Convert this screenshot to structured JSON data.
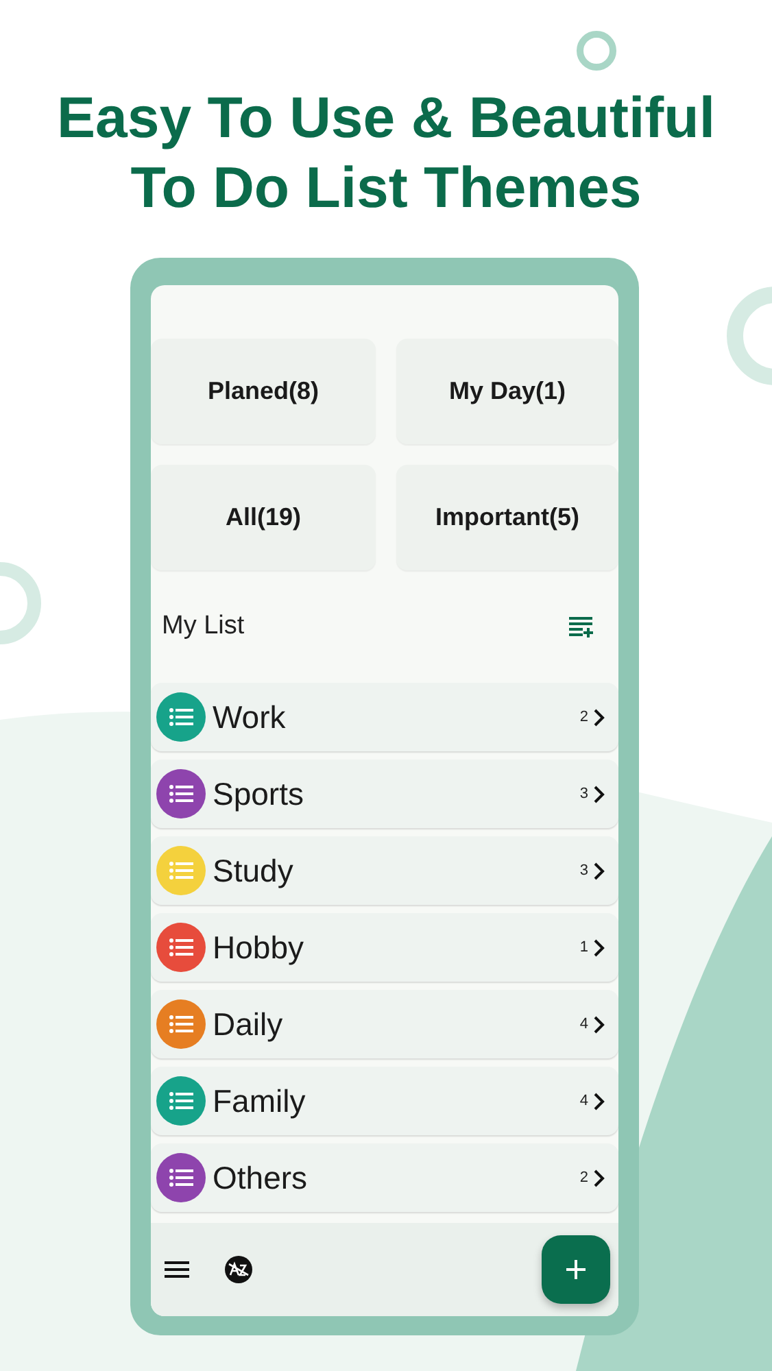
{
  "headline": [
    "Easy To Use & Beautiful",
    "To Do List Themes"
  ],
  "tiles": [
    {
      "label": "Planed(8)"
    },
    {
      "label": "My Day(1)"
    },
    {
      "label": "All(19)"
    },
    {
      "label": "Important(5)"
    }
  ],
  "section": {
    "title": "My List"
  },
  "lists": [
    {
      "name": "Work",
      "count": "2",
      "color": "#17a38a"
    },
    {
      "name": "Sports",
      "count": "3",
      "color": "#8e44ad"
    },
    {
      "name": "Study",
      "count": "3",
      "color": "#f4d13d"
    },
    {
      "name": "Hobby",
      "count": "1",
      "color": "#e74c3c"
    },
    {
      "name": "Daily",
      "count": "4",
      "color": "#e67e22"
    },
    {
      "name": "Family",
      "count": "4",
      "color": "#17a38a"
    },
    {
      "name": "Others",
      "count": "2",
      "color": "#8e44ad"
    }
  ]
}
